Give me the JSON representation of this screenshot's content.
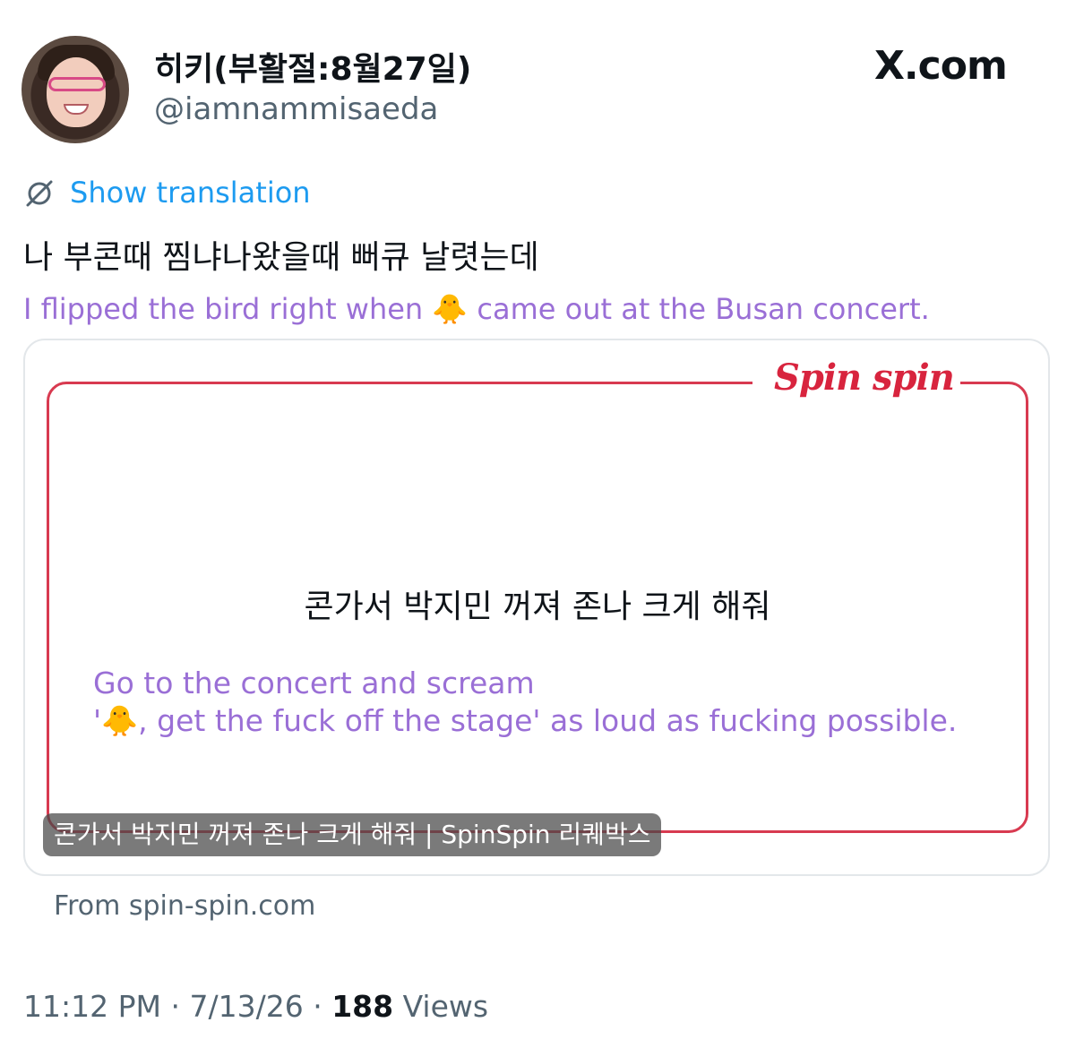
{
  "author": {
    "display_name": "히키(부활절:8월27일)",
    "handle": "@iamnammisaeda"
  },
  "brand_logo": "X.com",
  "translation_toggle": {
    "label": "Show translation",
    "icon": "globe-strikethrough-icon"
  },
  "tweet": {
    "text_original": "나 부콘때 찜냐나왔을때 뻐큐 날렷는데",
    "text_translated": "I flipped the bird right when 🐥 came out at the Busan concert."
  },
  "link_card": {
    "brand": "Spin spin",
    "quote_original": "콘가서 박지민 꺼져 존나 크게 해줘",
    "quote_translated_line1": "Go to the concert and scream",
    "quote_translated_line2": "'🐥, get the fuck off the stage' as loud as fucking possible.",
    "caption": "콘가서 박지민 꺼져 존나 크게 해줘 | SpinSpin 리퀘박스",
    "source": "From spin-spin.com"
  },
  "meta": {
    "time": "11:12 PM",
    "separator": "·",
    "date": "7/13/26",
    "views_count": "188",
    "views_label": "Views"
  },
  "colors": {
    "link_blue": "#1d9bf0",
    "translation_purple": "#9a6fd6",
    "brand_red": "#d8243e",
    "secondary_gray": "#536471"
  }
}
